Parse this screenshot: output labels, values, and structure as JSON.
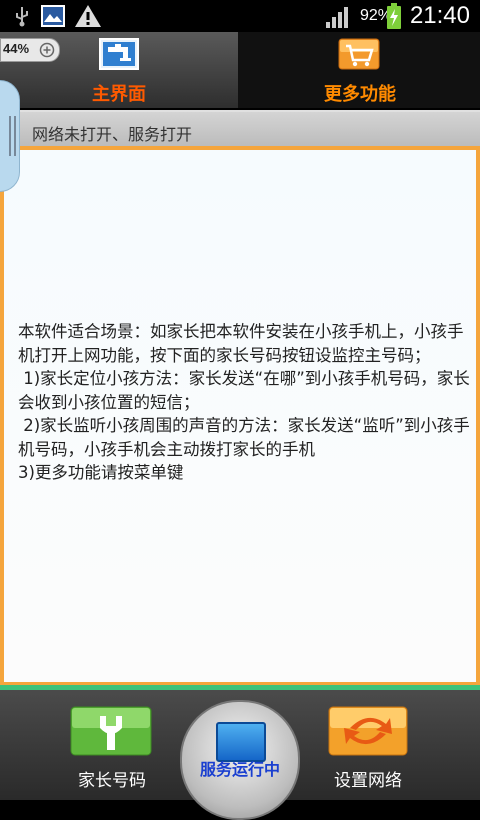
{
  "status_bar": {
    "battery_percent": "92%",
    "time": "21:40",
    "icons": [
      "usb-icon",
      "image-icon",
      "warning-icon",
      "signal-icon",
      "battery-charging-icon"
    ]
  },
  "battery_widget": {
    "percent": "44%"
  },
  "tabs": [
    {
      "label": "主界面",
      "icon": "faucet-icon",
      "selected": true
    },
    {
      "label": "更多功能",
      "icon": "cart-icon",
      "selected": false
    }
  ],
  "notice": "网络未打开、服务打开",
  "main_text": "本软件适合场景：如家长把本软件安装在小孩手机上，小孩手机打开上网功能，按下面的家长号码按钮设监控主号码；\n 1)家长定位小孩方法：家长发送“在哪”到小孩手机号码，家长会收到小孩位置的短信；\n 2)家长监听小孩周围的声音的方法：家长发送“监听”到小孩手机号码，小孩手机会主动拨打家长的手机\n3)更多功能请按菜单键",
  "bottom": {
    "parent_number_label": "家长号码",
    "service_label": "服务运行中",
    "network_label": "设置网络"
  },
  "colors": {
    "accent_orange": "#f5a53c",
    "green_bar": "#3ec27a",
    "tab_text": "#ff8a00"
  }
}
